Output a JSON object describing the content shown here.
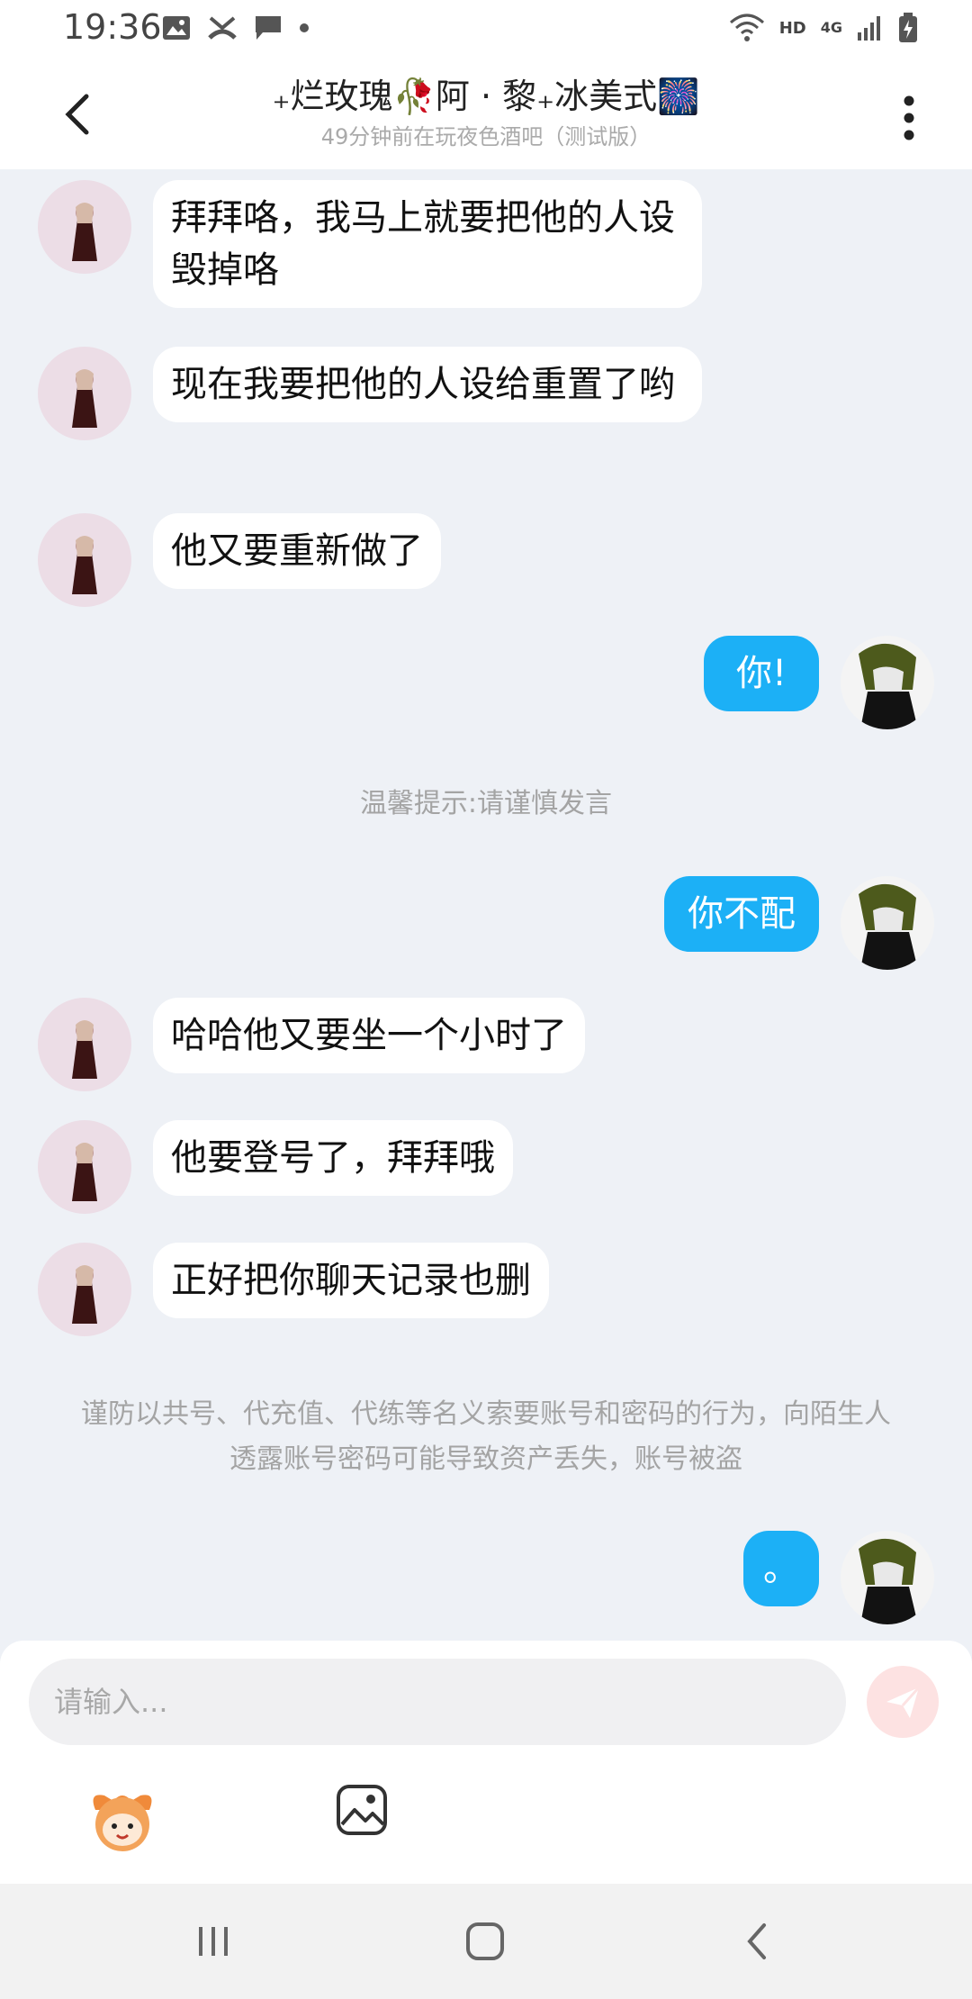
{
  "status_bar": {
    "time": "19:36",
    "hd": "HD",
    "network": "4G",
    "icons": [
      "image-icon",
      "missed-call-icon",
      "message-icon",
      "dot-icon",
      "wifi-icon",
      "signal-icon",
      "battery-icon"
    ]
  },
  "header": {
    "title": "₊烂玫瑰🥀阿 · 黎₊冰美式🎆",
    "subtitle": "49分钟前在玩夜色酒吧（测试版）"
  },
  "messages": [
    {
      "dir": "in",
      "text": "拜拜咯，我马上就要把他的人设毁掉咯"
    },
    {
      "dir": "in",
      "text": "现在我要把他的人设给重置了哟"
    },
    {
      "dir": "in",
      "text": "他又要重新做了"
    },
    {
      "dir": "out",
      "text": "你!"
    },
    {
      "dir": "notice",
      "text": "温馨提示:请谨慎发言"
    },
    {
      "dir": "out",
      "text": "你不配"
    },
    {
      "dir": "in",
      "text": "哈哈他又要坐一个小时了"
    },
    {
      "dir": "in",
      "text": "他要登号了，拜拜哦"
    },
    {
      "dir": "in",
      "text": "正好把你聊天记录也删"
    },
    {
      "dir": "notice",
      "text": "谨防以共号、代充值、代练等名义索要账号和密码的行为，向陌生人透露账号密码可能导致资产丢失，账号被盗"
    },
    {
      "dir": "out",
      "text": "。"
    }
  ],
  "composer": {
    "placeholder": "请输入..."
  },
  "colors": {
    "outgoing_bubble": "#1cb0f6",
    "background": "#eef1f6",
    "send_button": "#fde2e2"
  }
}
